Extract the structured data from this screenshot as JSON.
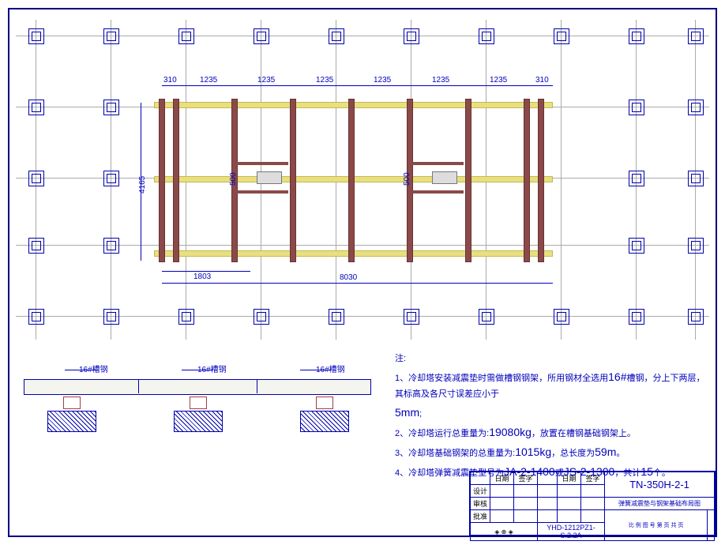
{
  "dims": {
    "top": [
      "310",
      "1235",
      "1235",
      "1235",
      "1235",
      "1235",
      "1235",
      "310"
    ],
    "left": "4165",
    "inner_v": "500",
    "inner_v2": "500",
    "btm1": "1803",
    "btm2": "8030"
  },
  "section": {
    "label1": "16#槽钢",
    "label2": "16#槽钢",
    "label3": "16#槽钢"
  },
  "notes": {
    "head": "注:",
    "n1a": "1、冷却塔安装减震垫时需做槽钢钢架，所用钢材全选用",
    "n1b": "16#",
    "n1c": "槽钢，分上下两层，其标高及各尺寸误差应小于",
    "n1d": "5mm",
    "n1e": ";",
    "n2a": "2、冷却塔运行总重量为:",
    "n2b": "19080kg",
    "n2c": "，放置在槽钢基础钢架上。",
    "n3a": "3、冷却塔基础钢架的总重量为:",
    "n3b": "1015kg",
    "n3c": "，总长度为",
    "n3d": "59m",
    "n3e": "。",
    "n4a": "4、冷却塔弹簧减震垫型号为",
    "n4b": "JA-2-1400",
    "n4c": "或",
    "n4d": "JS-2-1300",
    "n4e": "，共计",
    "n4f": "15",
    "n4g": "个。"
  },
  "title": {
    "model": "TN-350H-2-1",
    "desc": "弹簧减震垫与钢架基础布局图",
    "code": "YHD-1212PZ1-S.2.2A",
    "col1": "日期",
    "col2": "签字",
    "col3": "",
    "col4": "日期",
    "col5": "签字",
    "r1": "设计",
    "r2": "审核",
    "r3": "批准",
    "meta": "比 例 图 号 第 页 共 页"
  }
}
